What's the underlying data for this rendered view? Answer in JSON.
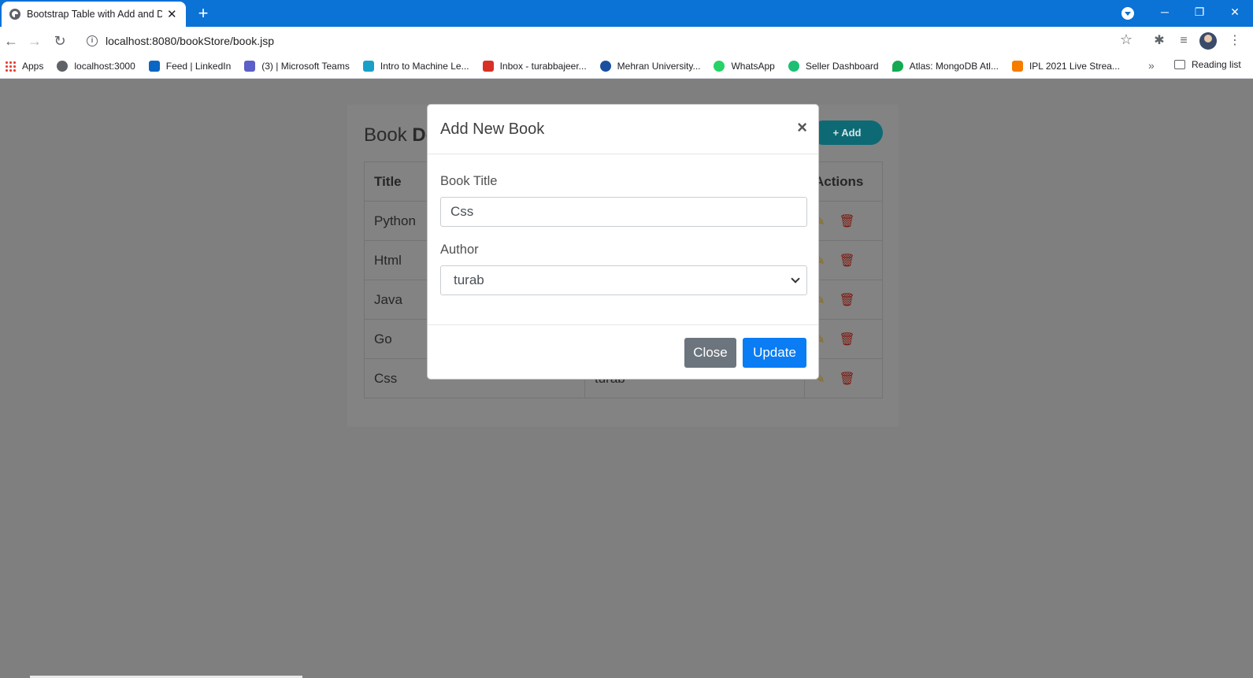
{
  "browser": {
    "tab_title": "Bootstrap Table with Add and De",
    "tab_close": "✕",
    "new_tab": "+",
    "url": "localhost:8080/bookStore/book.jsp",
    "window_controls": {
      "minimize": "─",
      "restore": "❐",
      "close": "✕"
    },
    "bookmarks": [
      {
        "label": "Apps",
        "color": "#e94235"
      },
      {
        "label": "localhost:3000",
        "color": "#5f6368"
      },
      {
        "label": "Feed | LinkedIn",
        "color": "#0a66c2"
      },
      {
        "label": "(3) | Microsoft Teams",
        "color": "#5b5fc7"
      },
      {
        "label": "Intro to Machine Le...",
        "color": "#1aa0c8"
      },
      {
        "label": "Inbox - turabbajeer...",
        "color": "#d93025"
      },
      {
        "label": "Mehran University...",
        "color": "#1a4fa0"
      },
      {
        "label": "WhatsApp",
        "color": "#25d366"
      },
      {
        "label": "Seller Dashboard",
        "color": "#1dbf73"
      },
      {
        "label": "Atlas: MongoDB Atl...",
        "color": "#13aa52"
      },
      {
        "label": "IPL 2021 Live Strea...",
        "color": "#f57c00"
      }
    ],
    "more": "»",
    "reading_list": "Reading list"
  },
  "page": {
    "heading_prefix": "Book ",
    "heading_bold": "De",
    "add_label": "+ Add",
    "table": {
      "headers": [
        "Title",
        "",
        "Actions"
      ],
      "rows": [
        {
          "title": "Python",
          "author": ""
        },
        {
          "title": "Html",
          "author": ""
        },
        {
          "title": "Java",
          "author": ""
        },
        {
          "title": "Go",
          "author": ""
        },
        {
          "title": "Css",
          "author": "turab"
        }
      ]
    }
  },
  "modal": {
    "title": "Add New Book",
    "close_x": "×",
    "book_title_label": "Book Title",
    "book_title_value": "Css",
    "author_label": "Author",
    "author_selected": "turab",
    "close_button": "Close",
    "update_button": "Update"
  }
}
